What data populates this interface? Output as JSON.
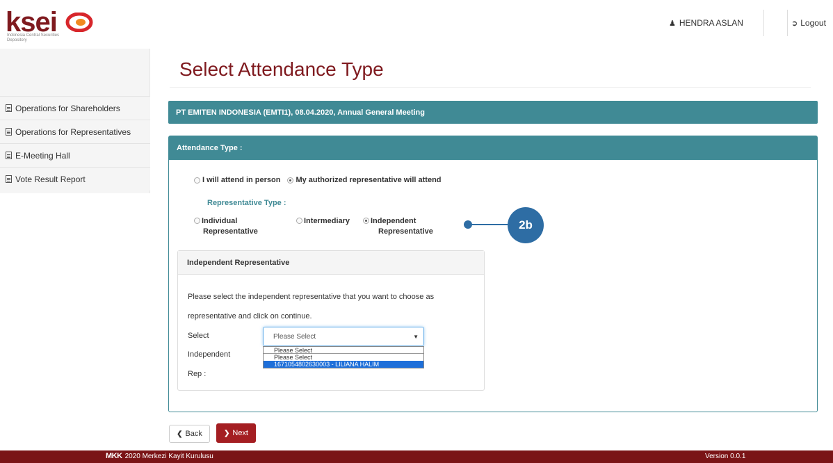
{
  "header": {
    "logo_text": "ksei",
    "logo_subtitle": "Indonesia Central Securities Depository",
    "user_name": "HENDRA ASLAN",
    "logout_label": "Logout"
  },
  "sidebar": {
    "items": [
      {
        "label": "Operations for Shareholders"
      },
      {
        "label": "Operations for Representatives"
      },
      {
        "label": "E-Meeting Hall"
      },
      {
        "label": "Vote Result Report"
      }
    ]
  },
  "page": {
    "title": "Select Attendance Type",
    "meeting_info": "PT EMITEN INDONESIA (EMTI1), 08.04.2020, Annual General Meeting"
  },
  "attendance": {
    "header": "Attendance Type :",
    "options": [
      {
        "label": "I will attend in person",
        "selected": false
      },
      {
        "label": "My authorized representative will attend",
        "selected": true
      }
    ],
    "rep_type_label": "Representative Type :",
    "rep_options": [
      {
        "line1": "Individual",
        "line2": "Representative",
        "selected": false
      },
      {
        "line1": "Intermediary",
        "line2": "",
        "selected": false
      },
      {
        "line1": "Independent",
        "line2": "Representative",
        "selected": true
      }
    ]
  },
  "callout": {
    "label": "2b"
  },
  "independent": {
    "header": "Independent Representative",
    "instruction": "Please select the independent representative that you want to choose as representative and click on continue.",
    "select_label": "Select",
    "label_line2": "Independent",
    "label_line3": "Rep :",
    "select_value": "Please Select",
    "dropdown_options": [
      "Please Select",
      "1671054802630003 - LILIANA HALIM"
    ],
    "highlighted_option": "1671054802630003 - LILIANA HALIM"
  },
  "buttons": {
    "back_label": "Back",
    "next_label": "Next"
  },
  "footer": {
    "brand": "MKK",
    "copyright": "2020 Merkezi Kayit Kurulusu",
    "version": "Version 0.0.1"
  },
  "colors": {
    "brand": "#7f1a1f",
    "panel_teal": "#408a95",
    "next_button": "#a41e22",
    "callout_blue": "#2e6da4",
    "footer": "#7a1416"
  }
}
